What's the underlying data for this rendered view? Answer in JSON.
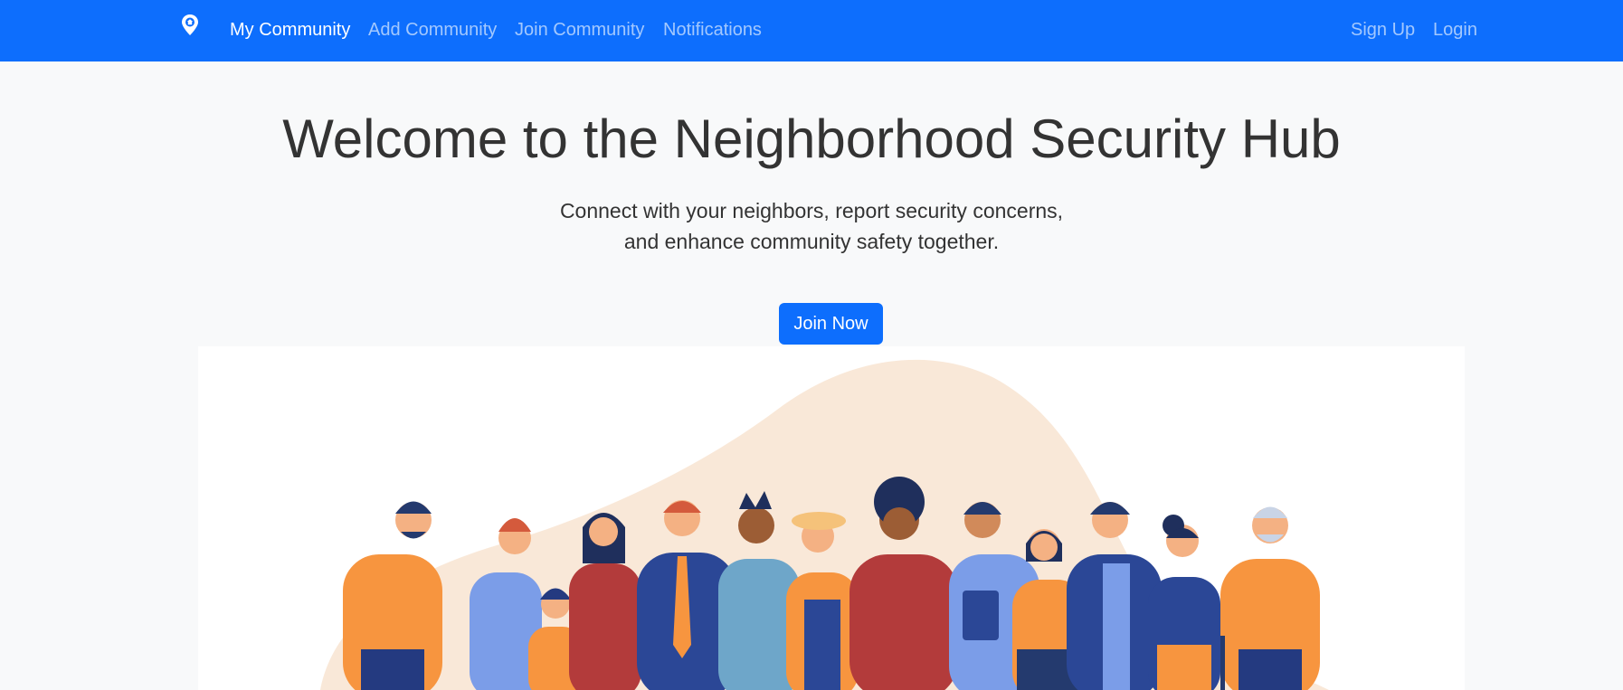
{
  "nav": {
    "brand_icon": "map-pin-icon",
    "links": [
      "My Community",
      "Add Community",
      "Join Community",
      "Notifications"
    ],
    "right_links": [
      "Sign Up",
      "Login"
    ],
    "active_index": 0,
    "bg_color": "#0d6efd"
  },
  "hero": {
    "title": "Welcome to the Neighborhood Security Hub",
    "lead_line1": "Connect with your neighbors, report security concerns,",
    "lead_line2": "and enhance community safety together.",
    "cta_label": "Join Now"
  },
  "illustration": {
    "icon": "community-people-illustration",
    "blob_color": "#f9e8d8"
  }
}
